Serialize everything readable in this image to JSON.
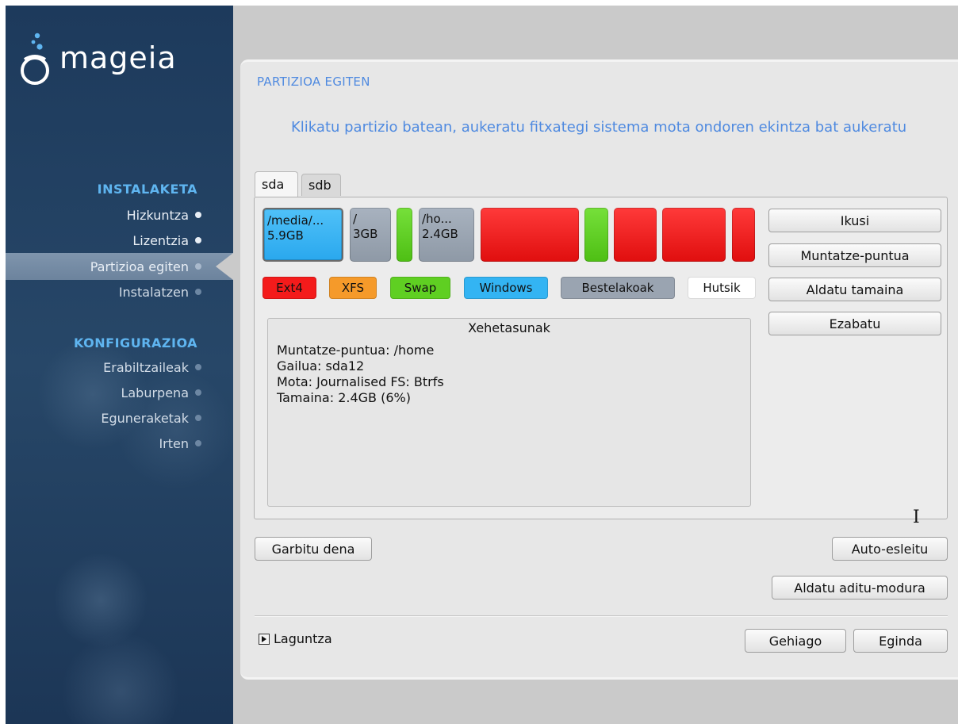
{
  "sidebar": {
    "brand": "mageia",
    "sections": [
      {
        "title": "INSTALAKETA",
        "items": [
          {
            "label": "Hizkuntza",
            "state": "done"
          },
          {
            "label": "Lizentzia",
            "state": "done"
          },
          {
            "label": "Partizioa egiten",
            "state": "active"
          },
          {
            "label": "Instalatzen",
            "state": "pending"
          }
        ]
      },
      {
        "title": "KONFIGURAZIOA",
        "items": [
          {
            "label": "Erabiltzaileak",
            "state": "pending"
          },
          {
            "label": "Laburpena",
            "state": "pending"
          },
          {
            "label": "Eguneraketak",
            "state": "pending"
          },
          {
            "label": "Irten",
            "state": "pending"
          }
        ]
      }
    ]
  },
  "main": {
    "title": "PARTIZIOA EGITEN",
    "subtitle": "Klikatu partizio batean, aukeratu fitxategi sistema mota ondoren ekintza bat aukeratu",
    "tabs": [
      {
        "label": "sda",
        "selected": true
      },
      {
        "label": "sdb",
        "selected": false
      }
    ],
    "partitions": [
      {
        "line1": "/media/...",
        "line2": "5.9GB",
        "color": "blue"
      },
      {
        "line1": "/",
        "line2": "3GB",
        "color": "gray"
      },
      {
        "line1": "",
        "line2": "",
        "color": "green"
      },
      {
        "line1": "/ho...",
        "line2": "2.4GB",
        "color": "gray"
      },
      {
        "line1": "",
        "line2": "",
        "color": "red"
      },
      {
        "line1": "",
        "line2": "",
        "color": "green"
      },
      {
        "line1": "",
        "line2": "",
        "color": "red"
      },
      {
        "line1": "",
        "line2": "",
        "color": "red"
      },
      {
        "line1": "",
        "line2": "",
        "color": "red"
      }
    ],
    "legend": [
      {
        "label": "Ext4",
        "color": "#f41b1b"
      },
      {
        "label": "XFS",
        "color": "#f59a2a"
      },
      {
        "label": "Swap",
        "color": "#5fcf22"
      },
      {
        "label": "Windows",
        "color": "#33b4f3"
      },
      {
        "label": "Bestelakoak",
        "color": "#9aa4b1"
      },
      {
        "label": "Hutsik",
        "color": "#ffffff"
      }
    ],
    "details": {
      "title": "Xehetasunak",
      "lines": [
        "Muntatze-puntua: /home",
        "Gailua: sda12",
        "Mota: Journalised FS: Btrfs",
        "Tamaina: 2.4GB (6%)"
      ]
    },
    "actions": {
      "view": "Ikusi",
      "mount_point": "Muntatze-puntua",
      "resize": "Aldatu tamaina",
      "delete": "Ezabatu"
    },
    "clear_all": "Garbitu dena",
    "auto_allocate": "Auto-esleitu",
    "expert_mode": "Aldatu aditu-modura",
    "help": "Laguntza",
    "more": "Gehiago",
    "done": "Eginda"
  }
}
